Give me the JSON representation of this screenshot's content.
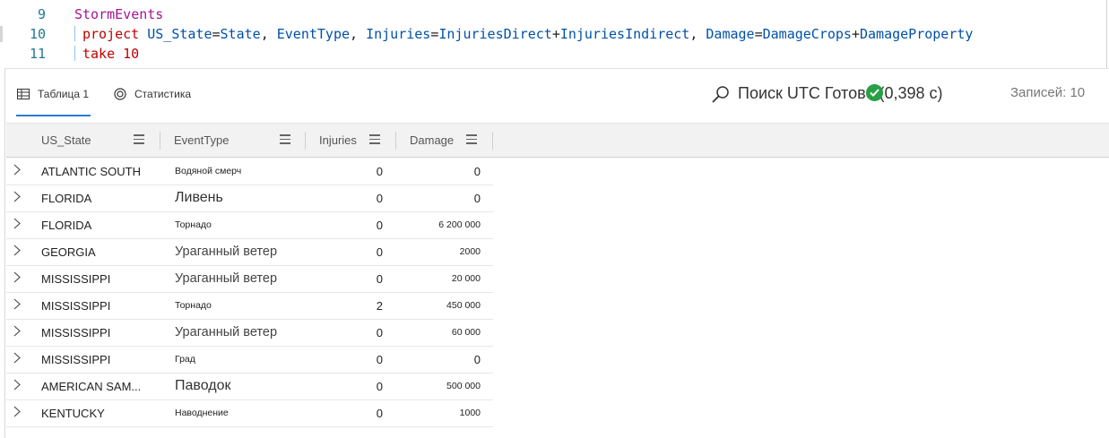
{
  "editor": {
    "lines": [
      {
        "num": "9",
        "tokens": [
          {
            "t": "StormEvents",
            "c": "kw-table"
          }
        ]
      },
      {
        "num": "10",
        "tokens": [
          {
            "t": "project ",
            "c": "kw"
          },
          {
            "t": "US_State",
            "c": "id"
          },
          {
            "t": "=",
            "c": "op"
          },
          {
            "t": "State",
            "c": "id"
          },
          {
            "t": ", ",
            "c": "op"
          },
          {
            "t": "EventType",
            "c": "id"
          },
          {
            "t": ", ",
            "c": "op"
          },
          {
            "t": "Injuries",
            "c": "id"
          },
          {
            "t": "=",
            "c": "op"
          },
          {
            "t": "InjuriesDirect",
            "c": "id"
          },
          {
            "t": "+",
            "c": "op"
          },
          {
            "t": "InjuriesIndirect",
            "c": "id"
          },
          {
            "t": ", ",
            "c": "op"
          },
          {
            "t": "Damage",
            "c": "id"
          },
          {
            "t": "=",
            "c": "op"
          },
          {
            "t": "DamageCrops",
            "c": "id"
          },
          {
            "t": "+",
            "c": "op"
          },
          {
            "t": "DamageProperty",
            "c": "id"
          }
        ]
      },
      {
        "num": "11",
        "tokens": [
          {
            "t": "take ",
            "c": "kw"
          },
          {
            "t": "10",
            "c": "kw"
          }
        ]
      }
    ]
  },
  "tabs": {
    "table_label": "Таблица 1",
    "stats_label": "Статистика"
  },
  "toolbar": {
    "search_label": "Поиск UTC Готово (0,398 с)",
    "records_label": "Записей: 10"
  },
  "grid": {
    "columns": [
      "US_State",
      "EventType",
      "Injuries",
      "Damage"
    ],
    "rows": [
      {
        "state": "ATLANTIC SOUTH",
        "event": "Водяной смерч",
        "event_size": "sm",
        "injuries": "0",
        "damage": "0",
        "damage_size": "n"
      },
      {
        "state": "FLORIDA",
        "event": "Ливень",
        "event_size": "xl",
        "injuries": "0",
        "damage": "0",
        "damage_size": "n"
      },
      {
        "state": "FLORIDA",
        "event": "Торнадо",
        "event_size": "sm",
        "injuries": "0",
        "damage": "6 200 000",
        "damage_size": "sm"
      },
      {
        "state": "GEORGIA",
        "event": "Ураганный ветер",
        "event_size": "lg",
        "injuries": "0",
        "damage": "2000",
        "damage_size": "sm"
      },
      {
        "state": "MISSISSIPPI",
        "event": "Ураганный ветер",
        "event_size": "lg",
        "injuries": "0",
        "damage": "20 000",
        "damage_size": "sm"
      },
      {
        "state": "MISSISSIPPI",
        "event": "Торнадо",
        "event_size": "sm",
        "injuries": "2",
        "damage": "450 000",
        "damage_size": "sm"
      },
      {
        "state": "MISSISSIPPI",
        "event": "Ураганный ветер",
        "event_size": "lg",
        "injuries": "0",
        "damage": "60 000",
        "damage_size": "sm"
      },
      {
        "state": "MISSISSIPPI",
        "event": "Град",
        "event_size": "sm",
        "injuries": "0",
        "damage": "0",
        "damage_size": "n"
      },
      {
        "state": "AMERICAN SAM...",
        "event": "Паводок",
        "event_size": "xl",
        "injuries": "0",
        "damage": "500 000",
        "damage_size": "sm"
      },
      {
        "state": "KENTUCKY",
        "event": "Наводнение",
        "event_size": "sm",
        "injuries": "0",
        "damage": "1000",
        "damage_size": "sm"
      }
    ]
  },
  "colors": {
    "accent": "#2b7bd3",
    "status_ok": "#27a046"
  }
}
